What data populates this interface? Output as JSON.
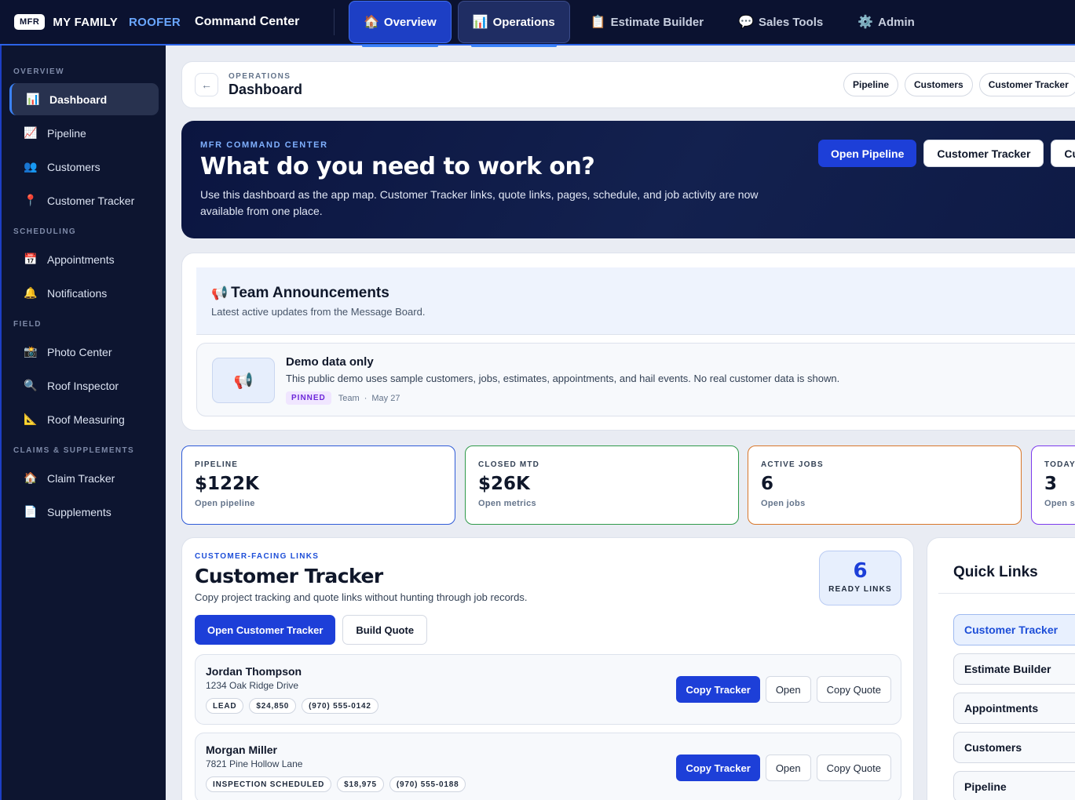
{
  "brand": {
    "logo": "MFR",
    "name": "MY FAMILY",
    "accent": "ROOFER",
    "app": "Command Center"
  },
  "topnav": [
    {
      "label": "Overview",
      "icon": "🏠"
    },
    {
      "label": "Operations",
      "icon": "📊"
    },
    {
      "label": "Estimate Builder",
      "icon": "📋"
    },
    {
      "label": "Sales Tools",
      "icon": "💬"
    },
    {
      "label": "Admin",
      "icon": "⚙️"
    }
  ],
  "sidebar": {
    "sections": [
      {
        "title": "OVERVIEW",
        "items": [
          {
            "label": "Dashboard",
            "icon": "📊"
          },
          {
            "label": "Pipeline",
            "icon": "📈"
          },
          {
            "label": "Customers",
            "icon": "👥"
          },
          {
            "label": "Customer Tracker",
            "icon": "📍"
          }
        ]
      },
      {
        "title": "SCHEDULING",
        "items": [
          {
            "label": "Appointments",
            "icon": "📅"
          },
          {
            "label": "Notifications",
            "icon": "🔔"
          }
        ]
      },
      {
        "title": "FIELD",
        "items": [
          {
            "label": "Photo Center",
            "icon": "📸"
          },
          {
            "label": "Roof Inspector",
            "icon": "🔍"
          },
          {
            "label": "Roof Measuring",
            "icon": "📐"
          }
        ]
      },
      {
        "title": "CLAIMS & SUPPLEMENTS",
        "items": [
          {
            "label": "Claim Tracker",
            "icon": "🏠"
          },
          {
            "label": "Supplements",
            "icon": "📄"
          }
        ]
      }
    ]
  },
  "breadcrumb": {
    "back": "←",
    "eyebrow": "OPERATIONS",
    "title": "Dashboard",
    "pills": [
      "Pipeline",
      "Customers",
      "Customer Tracker"
    ]
  },
  "hero": {
    "eyebrow": "MFR COMMAND CENTER",
    "title": "What do you need to work on?",
    "desc": "Use this dashboard as the app map. Customer Tracker links, quote links, pages, schedule, and job activity are now available from one place.",
    "btn_pipeline": "Open Pipeline",
    "btn_tracker": "Customer Tracker",
    "btn_customers": "Cus"
  },
  "announcements": {
    "icon": "📢",
    "title": "Team Announcements",
    "subtitle": "Latest active updates from the Message Board.",
    "card": {
      "icon": "📢",
      "title": "Demo data only",
      "text": "This public demo uses sample customers, jobs, estimates, appointments, and hail events. No real customer data is shown.",
      "badge": "PINNED",
      "author": "Team",
      "sep": "·",
      "date": "May 27"
    }
  },
  "stats": [
    {
      "label": "PIPELINE",
      "value": "$122K",
      "sub": "Open pipeline",
      "color": "#2f5bd7"
    },
    {
      "label": "CLOSED MTD",
      "value": "$26K",
      "sub": "Open metrics",
      "color": "#2f9a4a"
    },
    {
      "label": "ACTIVE JOBS",
      "value": "6",
      "sub": "Open jobs",
      "color": "#d9772a"
    },
    {
      "label": "TODAY",
      "value": "3",
      "sub": "Open s",
      "color": "#7c3aed"
    }
  ],
  "tracker": {
    "eyebrow": "CUSTOMER-FACING LINKS",
    "title": "Customer Tracker",
    "desc": "Copy project tracking and quote links without hunting through job records.",
    "ready_count": "6",
    "ready_label": "READY LINKS",
    "btn_open": "Open Customer Tracker",
    "btn_quote": "Build Quote",
    "customers": [
      {
        "name": "Jordan Thompson",
        "address": "1234 Oak Ridge Drive",
        "tags": [
          "LEAD",
          "$24,850",
          "(970) 555-0142"
        ]
      },
      {
        "name": "Morgan Miller",
        "address": "7821 Pine Hollow Lane",
        "tags": [
          "INSPECTION SCHEDULED",
          "$18,975",
          "(970) 555-0188"
        ]
      }
    ],
    "actions": {
      "copy_tracker": "Copy Tracker",
      "open": "Open",
      "copy_quote": "Copy Quote"
    }
  },
  "quick_links": {
    "title": "Quick Links",
    "items": [
      "Customer Tracker",
      "Estimate Builder",
      "Appointments",
      "Customers",
      "Pipeline"
    ]
  }
}
